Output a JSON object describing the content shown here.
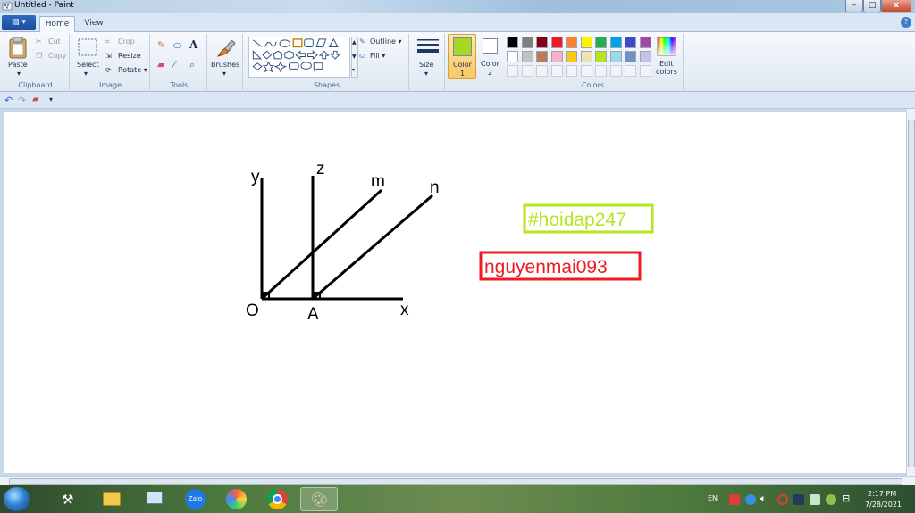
{
  "window": {
    "title": "Untitled - Paint",
    "minimize_glyph": "–",
    "maximize_glyph": "□",
    "close_glyph": "x"
  },
  "tabs": {
    "file_glyph": "▾",
    "home": "Home",
    "view": "View",
    "help_glyph": "?"
  },
  "clipboard": {
    "paste": "Paste",
    "cut": "Cut",
    "copy": "Copy",
    "label": "Clipboard"
  },
  "image": {
    "select": "Select",
    "crop": "Crop",
    "resize": "Resize",
    "rotate": "Rotate",
    "label": "Image"
  },
  "tools": {
    "label": "Tools",
    "text_tool_glyph": "A"
  },
  "brushes": {
    "label": "Brushes"
  },
  "shapes": {
    "outline": "Outline",
    "fill": "Fill",
    "label": "Shapes"
  },
  "size": {
    "label": "Size"
  },
  "color1": {
    "label": "Color",
    "num": "1",
    "value": "#a6d82a"
  },
  "color2": {
    "label": "Color",
    "num": "2",
    "value": "#ffffff"
  },
  "colors": {
    "label": "Colors",
    "edit": "Edit",
    "edit2": "colors",
    "row1": [
      "#000000",
      "#7f7f7f",
      "#880015",
      "#ed1c24",
      "#ff7f27",
      "#fff200",
      "#22b14c",
      "#00a2e8",
      "#3f48cc",
      "#a349a4"
    ],
    "row2": [
      "#ffffff",
      "#c3c3c3",
      "#b97a57",
      "#ffaec9",
      "#ffc90e",
      "#efe4b0",
      "#b5e61d",
      "#99d9ea",
      "#7092be",
      "#c8bfe7"
    ]
  },
  "drawing": {
    "label_y": "y",
    "label_z": "z",
    "label_m": "m",
    "label_n": "n",
    "label_o": "O",
    "label_a": "A",
    "label_x": "x",
    "tag_green": "#hoidap247",
    "tag_red": "nguyenmai093",
    "green_color": "#b5e61d",
    "red_color": "#ed1c24"
  },
  "taskbar": {
    "lang": "EN",
    "time": "2:17 PM",
    "date": "7/28/2021",
    "zalo_label": "Zalo"
  }
}
